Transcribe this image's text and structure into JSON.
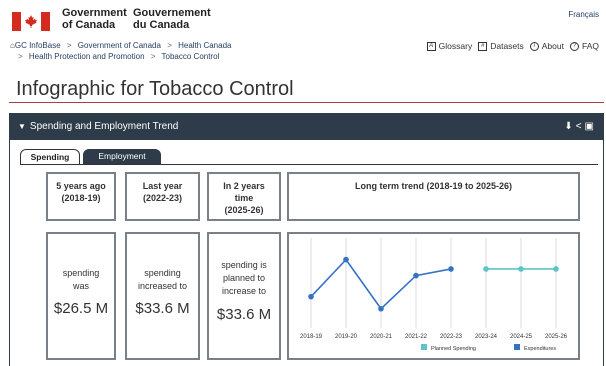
{
  "header": {
    "gov_en_line1": "Government",
    "gov_en_line2": "of Canada",
    "gov_fr_line1": "Gouvernement",
    "gov_fr_line2": "du Canada",
    "language_link": "Français"
  },
  "breadcrumb": {
    "items": [
      "GC InfoBase",
      "Government of Canada",
      "Health Canada",
      "Health Protection and Promotion",
      "Tobacco Control"
    ],
    "separator": ">"
  },
  "toolbar": {
    "glossary": "Glossary",
    "datasets": "Datasets",
    "about": "About",
    "faq": "FAQ"
  },
  "page_title": "Infographic for Tobacco Control",
  "panel": {
    "title": "Spending and Employment Trend",
    "tabs": [
      {
        "label": "Spending",
        "active": true
      },
      {
        "label": "Employment",
        "active": false
      }
    ]
  },
  "cards": [
    {
      "head_line1": "5 years ago",
      "head_line2": "(2018-19)",
      "head_line3": "",
      "label_line1": "spending",
      "label_line2": "was",
      "label_line3": "",
      "amount": "$26.5 M"
    },
    {
      "head_line1": "Last year",
      "head_line2": "(2022-23)",
      "head_line3": "",
      "label_line1": "spending",
      "label_line2": "increased to",
      "label_line3": "",
      "amount": "$33.6 M"
    },
    {
      "head_line1": "In 2 years",
      "head_line2": "time",
      "head_line3": "(2025-26)",
      "label_line1": "spending is",
      "label_line2": "planned to",
      "label_line3": "increase to",
      "amount": "$33.6 M"
    }
  ],
  "trend_card": {
    "title": "Long term trend (2018-19 to 2025-26)"
  },
  "colors": {
    "accent_red": "#af3c43",
    "panel_dark": "#2e3b48",
    "expenditures": "#3572c6",
    "planned": "#5ec4c6"
  },
  "chart_data": {
    "type": "line",
    "title": "Long term trend (2018-19 to 2025-26)",
    "categories": [
      "2018-19",
      "2019-20",
      "2020-21",
      "2021-22",
      "2022-23",
      "2023-24",
      "2024-25",
      "2025-26"
    ],
    "series": [
      {
        "name": "Expenditures",
        "color": "#3572c6",
        "values": [
          26.5,
          36.0,
          23.4,
          31.9,
          33.6,
          null,
          null,
          null
        ]
      },
      {
        "name": "Planned Spending",
        "color": "#5ec4c6",
        "values": [
          null,
          null,
          null,
          null,
          null,
          33.6,
          33.6,
          33.6
        ]
      }
    ],
    "legend": [
      "Planned Spending",
      "Expenditures"
    ],
    "legend_position": "bottom-right",
    "ylim": [
      20,
      40
    ],
    "grid": true
  }
}
